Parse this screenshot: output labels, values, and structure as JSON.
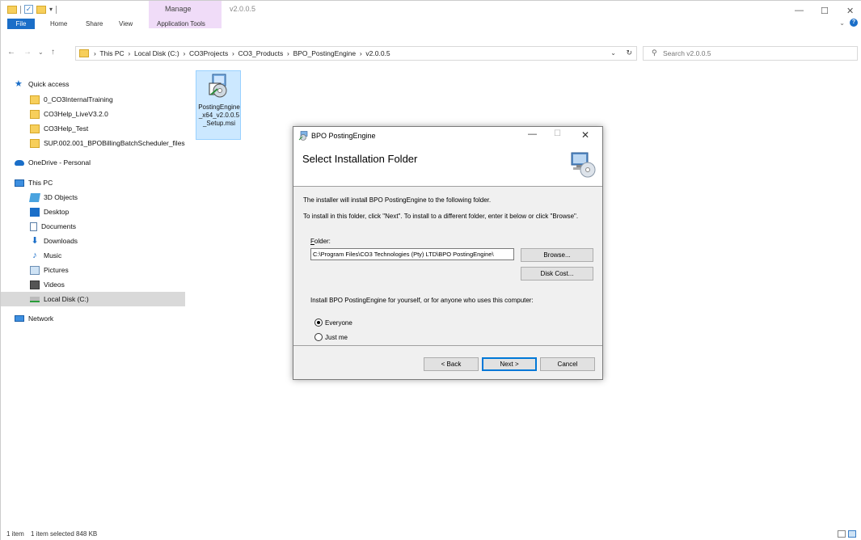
{
  "explorer": {
    "title": "v2.0.0.5",
    "manage_label": "Manage",
    "tabs": {
      "file": "File",
      "home": "Home",
      "share": "Share",
      "view": "View",
      "application_tools": "Application Tools"
    },
    "breadcrumb": [
      "This PC",
      "Local Disk (C:)",
      "CO3Projects",
      "CO3_Products",
      "BPO_PostingEngine",
      "v2.0.0.5"
    ],
    "search_placeholder": "Search v2.0.0.5",
    "nav": {
      "quick_access": "Quick access",
      "quick_items": [
        "0_CO3InternalTraining",
        "CO3Help_LiveV3.2.0",
        "CO3Help_Test",
        "SUP.002.001_BPOBillingBatchScheduler_files"
      ],
      "onedrive": "OneDrive - Personal",
      "this_pc": "This PC",
      "pc_items": [
        "3D Objects",
        "Desktop",
        "Documents",
        "Downloads",
        "Music",
        "Pictures",
        "Videos",
        "Local Disk (C:)"
      ],
      "network": "Network"
    },
    "file": {
      "name": "PostingEngine_x64_v2.0.0.5_Setup.msi"
    },
    "status": {
      "count": "1 item",
      "selected": "1 item selected  848 KB"
    }
  },
  "dialog": {
    "title": "BPO PostingEngine",
    "heading": "Select Installation Folder",
    "line1": "The installer will install BPO PostingEngine to the following folder.",
    "line2": "To install in this folder, click \"Next\". To install to a different folder, enter it below or click \"Browse\".",
    "folder_label_rest": "older:",
    "folder_label_accel": "F",
    "folder_value": "C:\\Program Files\\CO3 Technologies (Pty) LTD\\BPO PostingEngine\\",
    "browse": "Browse...",
    "disk_cost": "Disk Cost...",
    "install_for": "Install BPO PostingEngine for yourself, or for anyone who uses this computer:",
    "options": {
      "everyone": "Everyone",
      "just_me": "Just me",
      "selected": "everyone"
    },
    "buttons": {
      "back": "< Back",
      "next": "Next >",
      "cancel": "Cancel"
    }
  }
}
